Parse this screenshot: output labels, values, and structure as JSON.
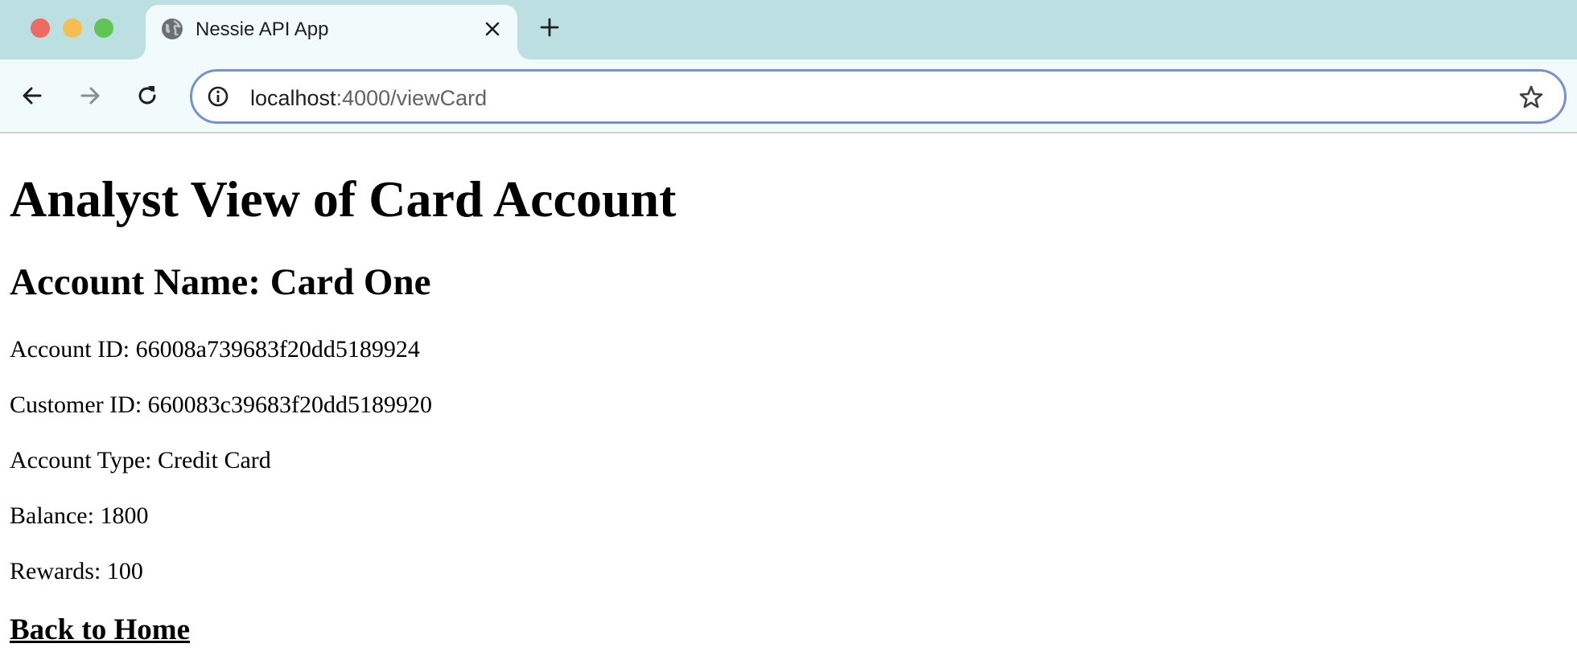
{
  "browser": {
    "tab_title": "Nessie API App",
    "url_host": "localhost",
    "url_path": ":4000/viewCard"
  },
  "page": {
    "heading": "Analyst View of Card Account",
    "account_name": "Account Name: Card One",
    "fields": [
      {
        "label": "Account ID: ",
        "value": "66008a739683f20dd5189924"
      },
      {
        "label": "Customer ID: ",
        "value": "660083c39683f20dd5189920"
      },
      {
        "label": "Account Type: ",
        "value": "Credit Card"
      },
      {
        "label": "Balance: ",
        "value": "1800"
      },
      {
        "label": "Rewards: ",
        "value": "100"
      }
    ],
    "home_link": "Back to Home"
  },
  "icons": {
    "favicon": "globe-icon",
    "close": "close-icon",
    "new_tab": "plus-icon",
    "back": "arrow-left-icon",
    "forward": "arrow-right-icon",
    "reload": "reload-icon",
    "site_info": "info-icon",
    "bookmark": "star-icon"
  },
  "colors": {
    "tabstrip": "#bce0e1",
    "omnibox_border": "#7592cf"
  }
}
